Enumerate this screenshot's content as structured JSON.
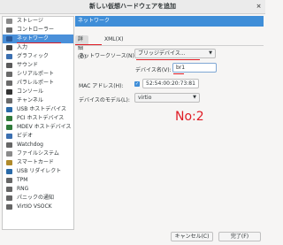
{
  "window": {
    "title": "新しい仮想ハードウェアを追加",
    "close_glyph": "×"
  },
  "sidebar": {
    "items": [
      {
        "label": "ストレージ",
        "icon": "storage-icon",
        "color": "#8a8a8a"
      },
      {
        "label": "コントローラー",
        "icon": "controller-icon",
        "color": "#6c6c6c"
      },
      {
        "label": "ネットワーク",
        "icon": "network-icon",
        "color": "#2a5a9a"
      },
      {
        "label": "入力",
        "icon": "input-icon",
        "color": "#444444"
      },
      {
        "label": "グラフィック",
        "icon": "graphics-icon",
        "color": "#3b6fb0"
      },
      {
        "label": "サウンド",
        "icon": "sound-icon",
        "color": "#5a5a5a"
      },
      {
        "label": "シリアルポート",
        "icon": "serial-icon",
        "color": "#6a6a6a"
      },
      {
        "label": "パラレルポート",
        "icon": "parallel-icon",
        "color": "#6a6a6a"
      },
      {
        "label": "コンソール",
        "icon": "console-icon",
        "color": "#333333"
      },
      {
        "label": "チャンネル",
        "icon": "channel-icon",
        "color": "#6a6a6a"
      },
      {
        "label": "USB ホストデバイス",
        "icon": "usb-icon",
        "color": "#2a6aa8"
      },
      {
        "label": "PCI ホストデバイス",
        "icon": "pci-icon",
        "color": "#2f7a3a"
      },
      {
        "label": "MDEV ホストデバイス",
        "icon": "mdev-icon",
        "color": "#2f7a3a"
      },
      {
        "label": "ビデオ",
        "icon": "video-icon",
        "color": "#3b6fb0"
      },
      {
        "label": "Watchdog",
        "icon": "watchdog-icon",
        "color": "#666666"
      },
      {
        "label": "ファイルシステム",
        "icon": "filesystem-icon",
        "color": "#8a8a8a"
      },
      {
        "label": "スマートカード",
        "icon": "smartcard-icon",
        "color": "#b08a2a"
      },
      {
        "label": "USB リダイレクト",
        "icon": "usb-redirect-icon",
        "color": "#2a6aa8"
      },
      {
        "label": "TPM",
        "icon": "tpm-icon",
        "color": "#666666"
      },
      {
        "label": "RNG",
        "icon": "rng-icon",
        "color": "#666666"
      },
      {
        "label": "パニックの通知",
        "icon": "panic-icon",
        "color": "#666666"
      },
      {
        "label": "VirtIO VSOCK",
        "icon": "vsock-icon",
        "color": "#666666"
      }
    ],
    "selected_index": 2
  },
  "main": {
    "header": "ネットワーク",
    "tabs": [
      {
        "label": "詳細(D)"
      },
      {
        "label": "XML(X)"
      }
    ],
    "active_tab": 0,
    "fields": {
      "source_label": "ネットワークソース(N):",
      "source_value": "ブリッジデバイス...",
      "device_name_label": "デバイス名(V):",
      "device_name_value": "br1",
      "mac_label": "MAC アドレス(H):",
      "mac_value": "52:54:00:20:73:81",
      "model_label": "デバイスのモデル(L):",
      "model_value": "virtio"
    },
    "annotation": "No:2"
  },
  "buttons": {
    "cancel": "キャンセル(C)",
    "finish": "完了(F)"
  },
  "colors": {
    "accent": "#3f8ed8",
    "annotation": "#e01b24"
  }
}
